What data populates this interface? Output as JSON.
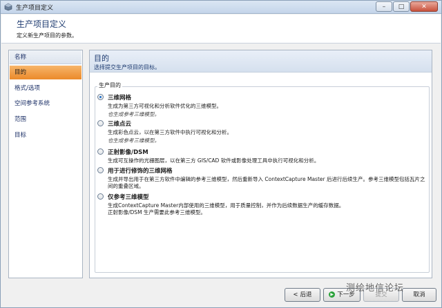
{
  "window": {
    "title": "生产项目定义"
  },
  "header": {
    "title": "生产项目定义",
    "subtitle": "定义新生产项目的参数。"
  },
  "sidebar": {
    "items": [
      {
        "label": "名称"
      },
      {
        "label": "目的"
      },
      {
        "label": "格式/选项"
      },
      {
        "label": "空间参考系统"
      },
      {
        "label": "范围"
      },
      {
        "label": "目标"
      }
    ]
  },
  "main": {
    "title": "目的",
    "subtitle": "选择提交生产项目的目标。",
    "group_label": "生产目的",
    "options": [
      {
        "label": "三维网格",
        "desc": "生成为第三方可视化和分析软件优化的三维模型。",
        "note": "也生成参考三维模型。",
        "checked": true
      },
      {
        "label": "三维点云",
        "desc": "生成彩色点云，以在第三方软件中执行可视化和分析。",
        "note": "也生成参考三维模型。",
        "checked": false
      },
      {
        "label": "正射影像/DSM",
        "desc": "生成可互操作的光栅图层，以在第三方 GIS/CAD 软件或影像处理工具中执行可视化和分析。",
        "note": "",
        "checked": false
      },
      {
        "label": "用于进行修饰的三维网格",
        "desc": "生成并导出用于在第三方软件中编辑的参考三维模型，然后重新导入 ContextCapture Master 后进行后续生产。参考三维模型包括瓦片之间的重叠区域。",
        "note": "",
        "checked": false
      },
      {
        "label": "仅参考三维模型",
        "desc": "生成ContextCapture Master内部使用的三维模型，用于质量控制，并作为后续数据生产的缓存数据。",
        "desc2": "正射影像/DSM 生产需要此参考三维模型。",
        "note": "",
        "checked": false
      }
    ]
  },
  "footer": {
    "back_label": "后退",
    "next_label": "下一步",
    "finish_label": "提交",
    "cancel_label": "取消"
  },
  "watermark": "测绘地信论坛"
}
